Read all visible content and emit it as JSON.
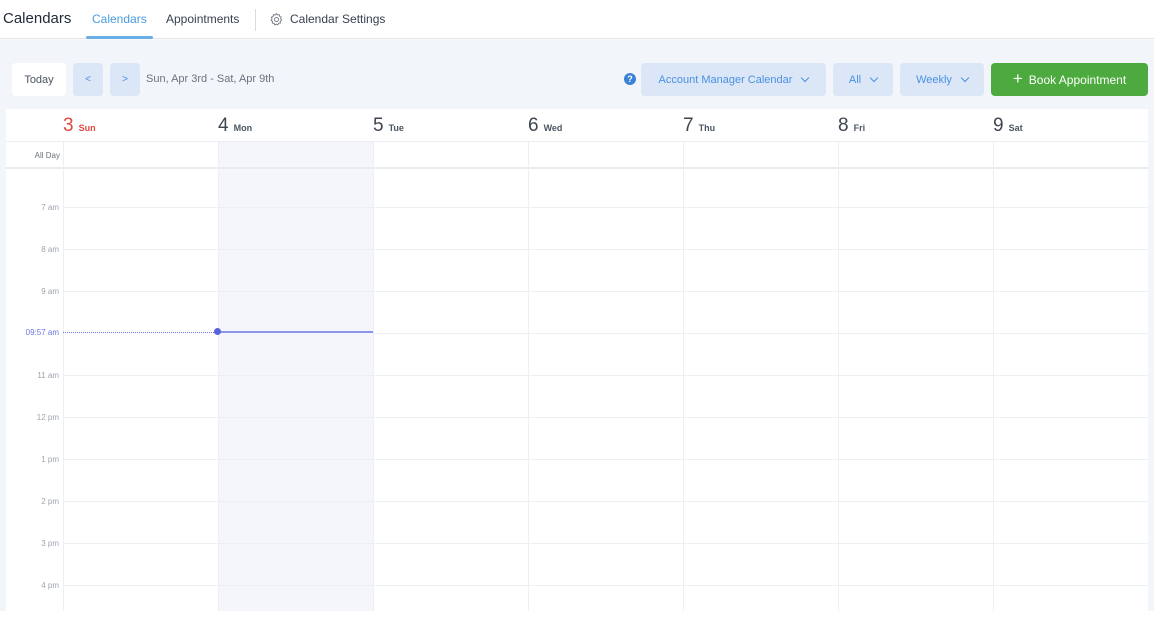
{
  "header": {
    "app_title": "Calendars",
    "tabs": [
      {
        "label": "Calendars",
        "active": true
      },
      {
        "label": "Appointments",
        "active": false
      }
    ],
    "settings_label": "Calendar Settings",
    "settings_icon": "gear-icon"
  },
  "toolbar": {
    "today_label": "Today",
    "prev_label": "<",
    "next_label": ">",
    "date_range": "Sun, Apr 3rd - Sat, Apr 9th",
    "help_icon": "question-circle-icon",
    "calendar_select": "Account Manager Calendar",
    "filter_select": "All",
    "view_select": "Weekly",
    "book_label": "Book Appointment",
    "accent_color": "#4caa3e"
  },
  "calendar": {
    "days": [
      {
        "num": "3",
        "name": "Sun",
        "today": true
      },
      {
        "num": "4",
        "name": "Mon",
        "today": false
      },
      {
        "num": "5",
        "name": "Tue",
        "today": false
      },
      {
        "num": "6",
        "name": "Wed",
        "today": false
      },
      {
        "num": "7",
        "name": "Thu",
        "today": false
      },
      {
        "num": "8",
        "name": "Fri",
        "today": false
      },
      {
        "num": "9",
        "name": "Sat",
        "today": false
      }
    ],
    "all_day_label": "All Day",
    "hours": [
      "7 am",
      "8 am",
      "9 am",
      "11 am",
      "12 pm",
      "1 pm",
      "2 pm",
      "3 pm",
      "4 pm"
    ],
    "current_time": "09:57 am",
    "current_time_color": "#6d74e0"
  }
}
